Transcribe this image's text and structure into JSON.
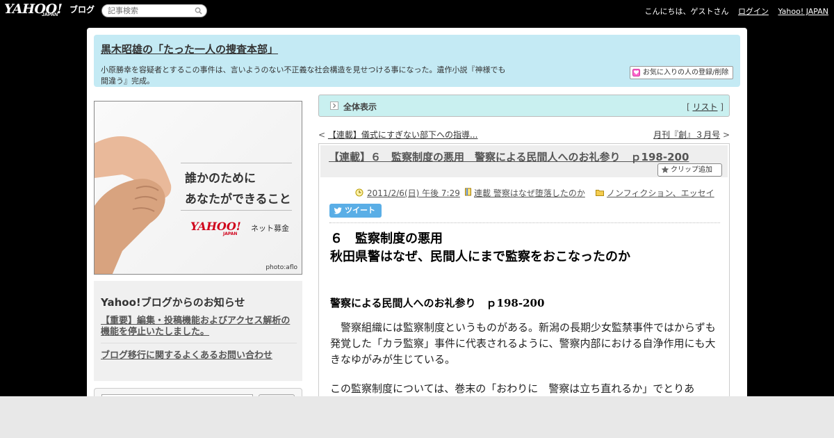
{
  "topbar": {
    "logo": "YAHOO!",
    "logo_sub": "JAPAN",
    "logo_blog": "ブログ",
    "search_placeholder": "記事検索",
    "greeting": "こんにちは、ゲストさん",
    "login": "ログイン",
    "yahoo_japan": "Yahoo! JAPAN"
  },
  "header": {
    "title": "黒木昭雄の「たった一人の捜査本部」",
    "description": "小原勝幸を容疑者とするこの事件は、言いようのない不正義な社会構造を見せつける事になった。遺作小説『神様でも間違う』完成。",
    "fav_button": "お気に入りの人の登録/削除"
  },
  "ad": {
    "line1": "誰かのために",
    "line2": "あなたができること",
    "logo": "YAHOO!",
    "logo_sub": "JAPAN",
    "service": "ネット募金",
    "credit": "photo:aflo"
  },
  "notice": {
    "title": "Yahoo!ブログからのお知らせ",
    "item1": "【重要】編集・投稿機能およびアクセス解析の機能を停止いたしました。",
    "item2": "ブログ移行に関するよくあるお問い合わせ"
  },
  "allview": {
    "label": "全体表示",
    "list_open": "[ ",
    "list_link": "リスト",
    "list_close": " ]"
  },
  "nav": {
    "prev_arrow": "< ",
    "prev": "【連載】儀式にすぎない部下への指導...",
    "next": "月刊『創』３月号",
    "next_arrow": " >"
  },
  "article": {
    "title": "【連載】６　監察制度の悪用　警察による民間人へのお礼参り　ｐ198-200",
    "clip_button": "クリップ追加",
    "date": "2011/2/6(日) 午後 7:29",
    "category": "連載 警察はなぜ堕落したのか",
    "genre": "ノンフィクション、エッセイ",
    "tweet": "ツイート",
    "heading1": "６　監察制度の悪用",
    "heading2": "秋田県警はなぜ、民間人にまで監察をおこなったのか",
    "subheading": "警察による民間人へのお礼参り　ｐ198-200",
    "para1": "　警察組織には監察制度というものがある。新潟の長期少女監禁事件ではからずも発覚した「カラ監察」事件に代表されるように、警察内部における自浄作用にも大きなゆがみが生じている。",
    "para2": "この監察制度については、巻末の「おわりに　警察は立ち直れるか」でとりあ"
  }
}
